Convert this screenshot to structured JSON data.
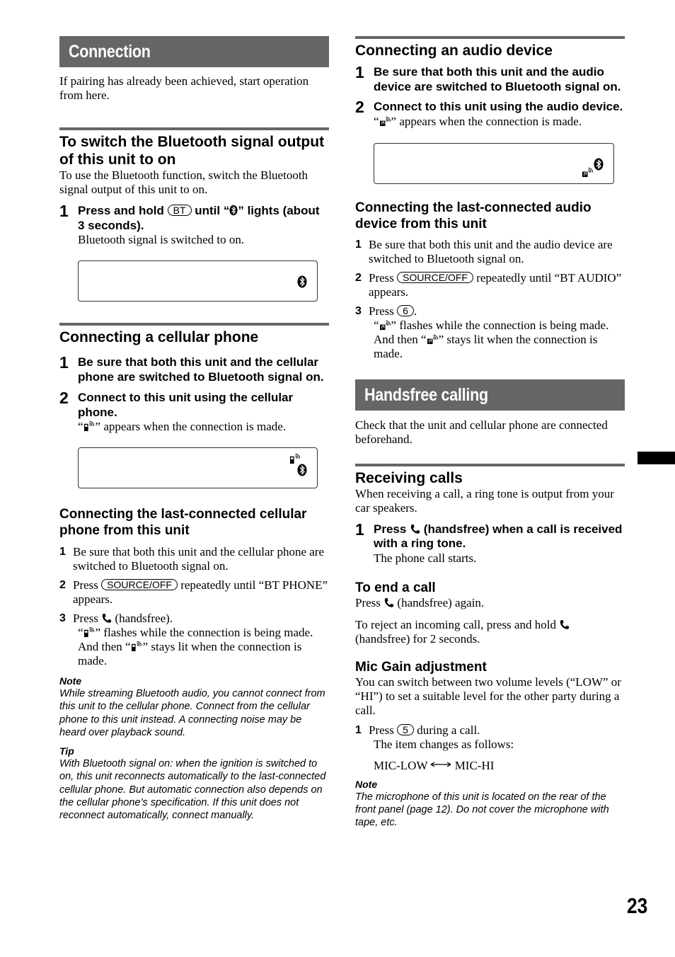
{
  "page_number": "23",
  "left": {
    "banner": "Connection",
    "intro": "If pairing has already been achieved, start operation from here.",
    "bt_section": {
      "title": "To switch the Bluetooth signal output of this unit to on",
      "body": "To use the Bluetooth function, switch the Bluetooth signal output of this unit to on.",
      "step1": {
        "num": "1",
        "pre": "Press and hold",
        "key": "BT",
        "mid": "until “",
        "post": "” lights (about 3 seconds).",
        "desc": "Bluetooth signal is switched to on."
      }
    },
    "cell_section": {
      "title": "Connecting a cellular phone",
      "step1": {
        "num": "1",
        "text": "Be sure that both this unit and the cellular phone are switched to Bluetooth signal on."
      },
      "step2": {
        "num": "2",
        "text": "Connect to this unit using the cellular phone.",
        "desc_pre": "“",
        "desc_post": "” appears when the connection is made."
      }
    },
    "last_cell_section": {
      "title": "Connecting the last-connected cellular phone from this unit",
      "steps": [
        {
          "num": "1",
          "text": "Be sure that both this unit and the cellular phone are switched to Bluetooth signal on."
        },
        {
          "num": "2",
          "pre": "Press",
          "key": "SOURCE/OFF",
          "post": "repeatedly until “BT PHONE” appears."
        },
        {
          "num": "3",
          "pre": "Press",
          "post": "(handsfree).",
          "desc_a": "“",
          "desc_b": "” flashes while the connection is being made. And then “",
          "desc_c": "” stays lit when the connection is made."
        }
      ]
    },
    "note": {
      "label": "Note",
      "text": "While streaming Bluetooth audio, you cannot connect from this unit to the cellular phone. Connect from the cellular phone to this unit instead. A connecting noise may be heard over playback sound."
    },
    "tip": {
      "label": "Tip",
      "text": "With Bluetooth signal on: when the ignition is switched to on, this unit reconnects automatically to the last-connected cellular phone. But automatic connection also depends on the cellular phone’s specification. If this unit does not reconnect automatically, connect manually."
    }
  },
  "right": {
    "audio_section": {
      "title": "Connecting an audio device",
      "step1": {
        "num": "1",
        "text": "Be sure that both this unit and the audio device are switched to Bluetooth signal on."
      },
      "step2": {
        "num": "2",
        "text": "Connect to this unit using the audio device.",
        "desc_pre": "“",
        "desc_post": "” appears when the connection is made."
      }
    },
    "last_audio_section": {
      "title": "Connecting the last-connected audio device from this unit",
      "steps": [
        {
          "num": "1",
          "text": "Be sure that both this unit and the audio device are switched to Bluetooth signal on."
        },
        {
          "num": "2",
          "pre": "Press",
          "key": "SOURCE/OFF",
          "post": "repeatedly until “BT AUDIO” appears."
        },
        {
          "num": "3",
          "pre": "Press",
          "key": "6",
          "post": ".",
          "desc_a": "“",
          "desc_b": "” flashes while the connection is being made. And then “",
          "desc_c": "” stays lit when the connection is made."
        }
      ]
    },
    "banner": "Handsfree calling",
    "intro": "Check that the unit and cellular phone are connected beforehand.",
    "receiving": {
      "title": "Receiving calls",
      "body": "When receiving a call, a ring tone is output from your car speakers.",
      "step1": {
        "num": "1",
        "pre": "Press",
        "post": "(handsfree) when a call is received with a ring tone.",
        "desc": "The phone call starts."
      }
    },
    "end_call": {
      "title": "To end a call",
      "line1_pre": "Press",
      "line1_post": "(handsfree) again.",
      "line2_pre": "To reject an incoming call, press and hold",
      "line2_post": "(handsfree) for 2 seconds."
    },
    "mic_gain": {
      "title": "Mic Gain adjustment",
      "body": "You can switch between two volume levels (“LOW” or “HI”) to set a suitable level for the other party during a call.",
      "step1": {
        "num": "1",
        "pre": "Press",
        "key": "5",
        "post": "during a call.",
        "desc": "The item changes as follows:"
      },
      "cycle": {
        "from": "MIC-LOW",
        "to": "MIC-HI"
      }
    },
    "note": {
      "label": "Note",
      "text": "The microphone of this unit is located on the rear of the front panel (page 12). Do not cover the microphone with tape, etc."
    }
  }
}
